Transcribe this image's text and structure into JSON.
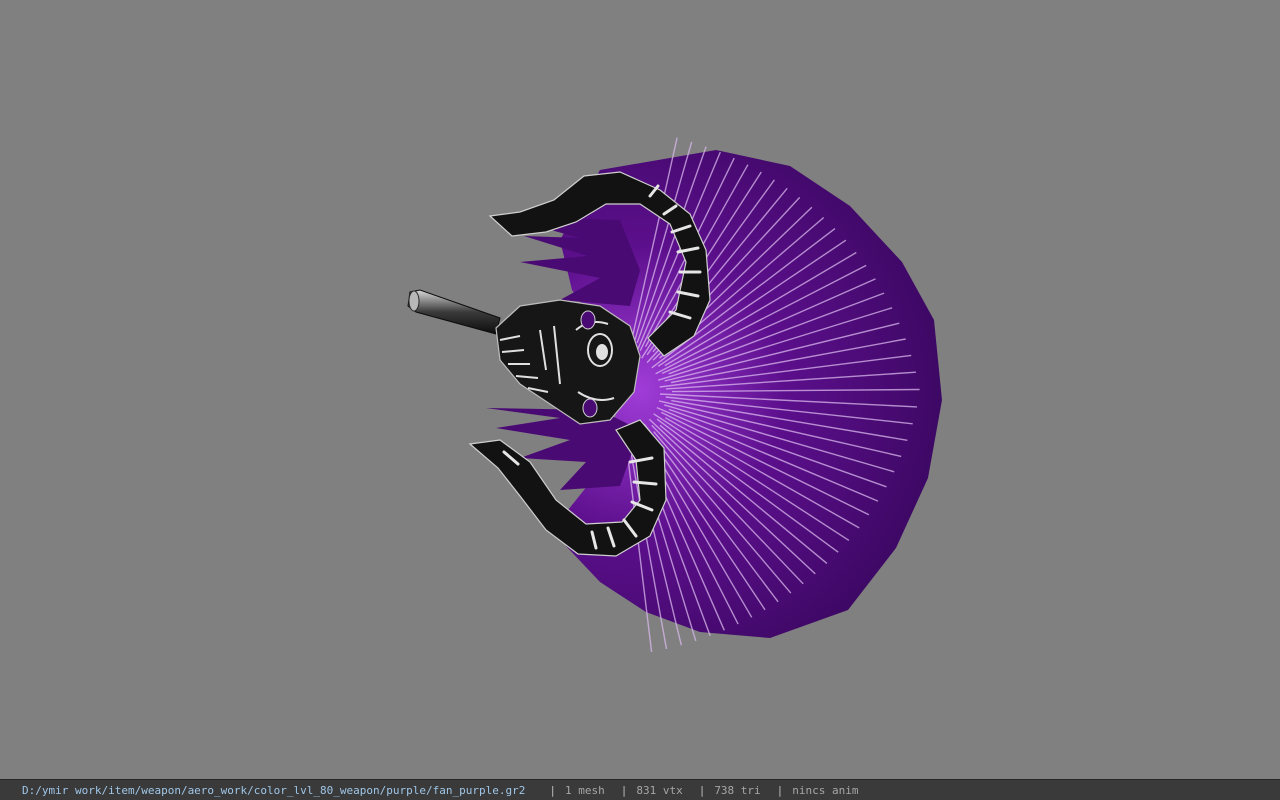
{
  "viewport": {
    "background_color": "#808080",
    "model": {
      "name": "fan_purple",
      "colors": {
        "fan_purple": "#5c0f8c",
        "fan_dark": "#2a0840",
        "fan_rib": "#cfa8e8",
        "metal_dark": "#141414",
        "metal_light": "#cfcfcf"
      }
    }
  },
  "statusbar": {
    "path": "D:/ymir work/item/weapon/aero_work/color_lvl_80_weapon/purple/fan_purple.gr2",
    "separator": "|",
    "mesh": "1 mesh",
    "vertices": "831 vtx",
    "triangles": "738 tri",
    "animation": "nincs anim"
  }
}
